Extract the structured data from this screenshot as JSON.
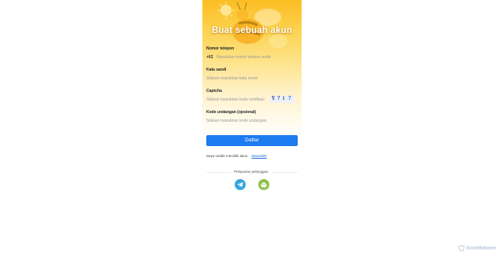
{
  "header": {
    "title": "Buat sebuah akun"
  },
  "form": {
    "phone": {
      "label": "Nomor telepon",
      "prefix": "+62",
      "placeholder": "Masukkan nomor telepon anda"
    },
    "password": {
      "label": "Kata sandi",
      "placeholder": "Silakan masukkan kata sandi"
    },
    "captcha": {
      "label": "Captcha",
      "placeholder": "Silakan masukkan kode verifikasi",
      "code": [
        "Y",
        "?",
        "i",
        "?"
      ]
    },
    "invite": {
      "label": "Kode undangan (opsional)",
      "placeholder": "Silakan masukkan kode undangan"
    }
  },
  "submit": {
    "label": "Daftar"
  },
  "login": {
    "text": "Saya sudah memiliki akun.",
    "link": "Masuklah"
  },
  "service": {
    "label": "Pelayanan pelanggan",
    "icons": [
      "telegram-icon",
      "android-icon"
    ]
  },
  "watermark": {
    "text": "ScanMalware"
  },
  "colors": {
    "accent": "#1e7bf0",
    "hero": "#fbbd22",
    "telegram": "#37a6df",
    "android": "#8bc34a"
  }
}
